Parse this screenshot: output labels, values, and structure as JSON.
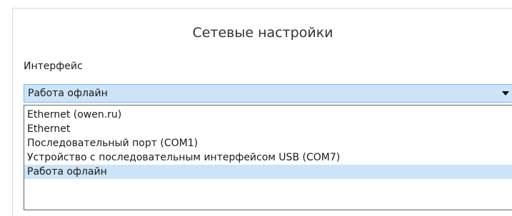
{
  "panel": {
    "title": "Сетевые настройки"
  },
  "interface": {
    "label": "Интерфейс",
    "selected_value": "Работа офлайн",
    "options": [
      "Ethernet (owen.ru)",
      "Ethernet",
      "Последовательный порт (COM1)",
      "Устройство с последовательным интерфейсом USB (COM7)",
      "Работа офлайн"
    ],
    "selected_index": 4,
    "arrow_icon": "chevron-down-icon"
  },
  "colors": {
    "selection_background": "#cce4f7",
    "combo_border": "#7eb4ea",
    "dropdown_border": "#646464"
  }
}
